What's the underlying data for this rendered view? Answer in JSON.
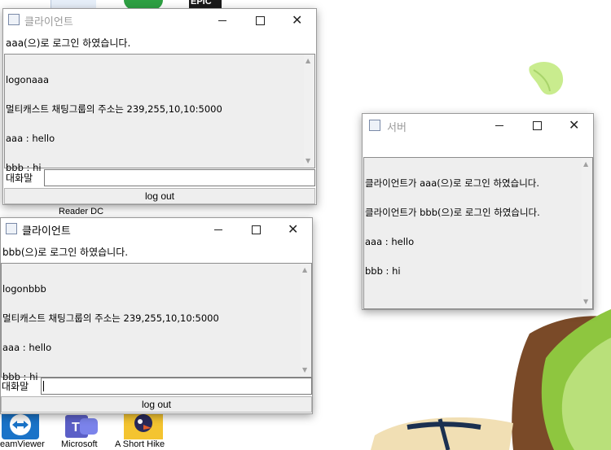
{
  "desktop": {
    "icons": [
      {
        "label": "Reader DC"
      },
      {
        "label": "eamViewer"
      },
      {
        "label": "Microsoft"
      },
      {
        "label": "A Short Hike"
      }
    ],
    "epic_text": "EPIC"
  },
  "client1": {
    "title": "클라이언트",
    "login_message": "aaa(으)로 로그인 하였습니다.",
    "log_lines": [
      "logonaaa",
      "멀티캐스트 채팅그룹의 주소는 239,255,10,10:5000",
      "aaa : hello",
      "bbb : hi"
    ],
    "chat_label": "대화말",
    "chat_value": "",
    "logout_label": "log out"
  },
  "client2": {
    "title": "클라이언트",
    "login_message": "bbb(으)로 로그인 하였습니다.",
    "log_lines": [
      "logonbbb",
      "멀티캐스트 채팅그룹의 주소는 239,255,10,10:5000",
      "aaa : hello",
      "bbb : hi"
    ],
    "chat_label": "대화말",
    "chat_value": "",
    "logout_label": "log out"
  },
  "server": {
    "title": "서버",
    "log_lines": [
      "클라이언트가 aaa(으)로 로그인 하였습니다.",
      "클라이언트가 bbb(으)로 로그인 하였습니다.",
      "aaa : hello",
      "bbb : hi"
    ]
  }
}
